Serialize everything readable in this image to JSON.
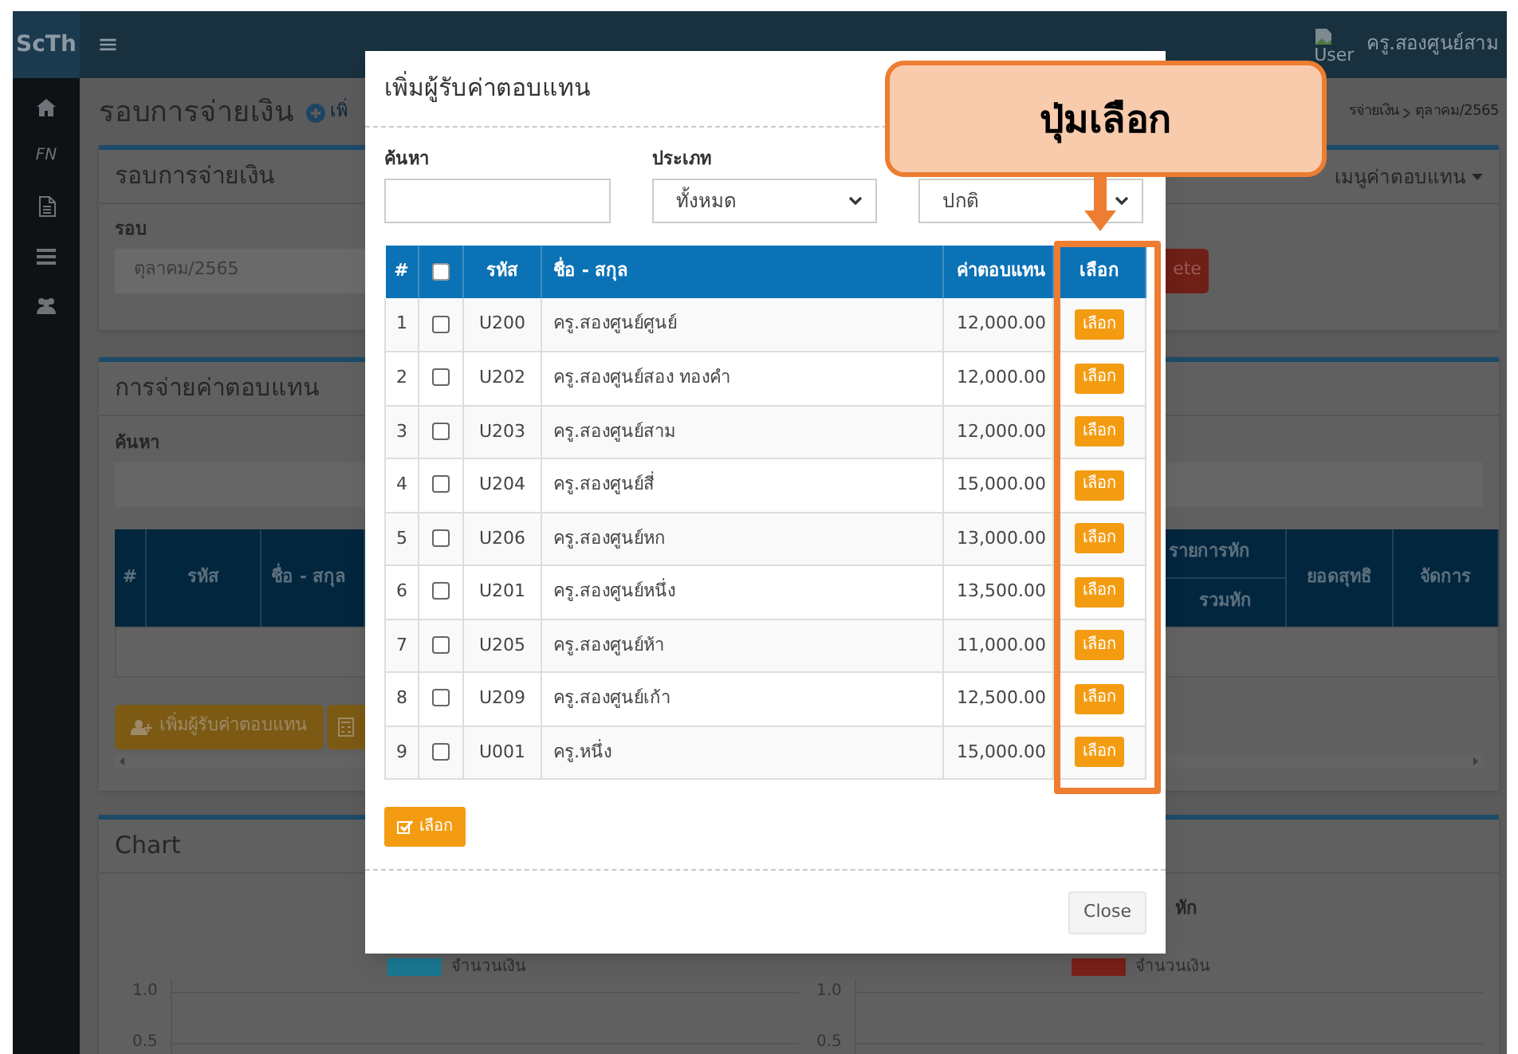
{
  "app": {
    "logo": "ScTh",
    "menu_glyph": "≡",
    "user": {
      "image_alt": "User",
      "name": "ครู.สองศูนย์สาม"
    }
  },
  "sidebar": {
    "items": [
      {
        "kind": "home"
      },
      {
        "kind": "text",
        "label": "FN"
      },
      {
        "kind": "file"
      },
      {
        "kind": "list"
      },
      {
        "kind": "users"
      }
    ]
  },
  "page": {
    "title": "รอบการจ่ายเงิน",
    "add_link": "เพิ่",
    "breadcrumb": [
      "รจ่ายเงิน",
      "ตุลาคม/2565"
    ]
  },
  "round_panel": {
    "title": "รอบการจ่ายเงิน",
    "menu": "เมนูค่าตอบแทน",
    "field_label": "รอบ",
    "field_value": "ตุลาคม/2565",
    "delete_button": "ete"
  },
  "payment_panel": {
    "title": "การจ่ายค่าตอบแทน",
    "search_label": "ค้นหา",
    "columns_left": [
      "#",
      "รหัส",
      "ชื่อ - สกุล"
    ],
    "deduction_group": "รายการหัก",
    "deduction_total": "รวมหัก",
    "columns_right": [
      "ยอดสุทธิ",
      "จัดการ"
    ],
    "add_button": "เพิ่มผู้รับค่าตอบแทน"
  },
  "chart_panel": {
    "title": "Chart",
    "charts": [
      {
        "legend": {
          "label": "จำนวนเงิน",
          "color": "#1b7a94"
        },
        "y_ticks": [
          "1.0",
          "0.5"
        ]
      },
      {
        "title": "หัก",
        "legend": {
          "label": "จำนวนเงิน",
          "color": "#7a2018"
        },
        "y_ticks": [
          "1.0",
          "0.5"
        ]
      }
    ]
  },
  "modal": {
    "title": "เพิ่มผู้รับค่าตอบแทน",
    "search_label": "ค้นหา",
    "type_label": "ประเภท",
    "type_value": "ทั้งหมด",
    "status_value": "ปกติ",
    "select_all_checked": false,
    "columns": {
      "number": "#",
      "code": "รหัส",
      "name": "ชื่อ - สกุล",
      "amount": "ค่าตอบแทน",
      "select": "เลือก"
    },
    "rows": [
      {
        "no": "1",
        "checked": false,
        "code": "U200",
        "name": "ครู.สองศูนย์ศูนย์",
        "amount": "12,000.00",
        "button": "เลือก"
      },
      {
        "no": "2",
        "checked": false,
        "code": "U202",
        "name": "ครู.สองศูนย์สอง ทองคำ",
        "amount": "12,000.00",
        "button": "เลือก"
      },
      {
        "no": "3",
        "checked": false,
        "code": "U203",
        "name": "ครู.สองศูนย์สาม",
        "amount": "12,000.00",
        "button": "เลือก"
      },
      {
        "no": "4",
        "checked": false,
        "code": "U204",
        "name": "ครู.สองศูนย์สี่",
        "amount": "15,000.00",
        "button": "เลือก"
      },
      {
        "no": "5",
        "checked": false,
        "code": "U206",
        "name": "ครู.สองศูนย์หก",
        "amount": "13,000.00",
        "button": "เลือก"
      },
      {
        "no": "6",
        "checked": false,
        "code": "U201",
        "name": "ครู.สองศูนย์หนึ่ง",
        "amount": "13,500.00",
        "button": "เลือก"
      },
      {
        "no": "7",
        "checked": false,
        "code": "U205",
        "name": "ครู.สองศูนย์ห้า",
        "amount": "11,000.00",
        "button": "เลือก"
      },
      {
        "no": "8",
        "checked": false,
        "code": "U209",
        "name": "ครู.สองศูนย์เก้า",
        "amount": "12,500.00",
        "button": "เลือก"
      },
      {
        "no": "9",
        "checked": false,
        "code": "U001",
        "name": "ครู.หนึ่ง",
        "amount": "15,000.00",
        "button": "เลือก"
      }
    ],
    "select_button": "เลือก",
    "close_button": "Close"
  },
  "callout": {
    "text": "ปุ่มเลือก"
  }
}
